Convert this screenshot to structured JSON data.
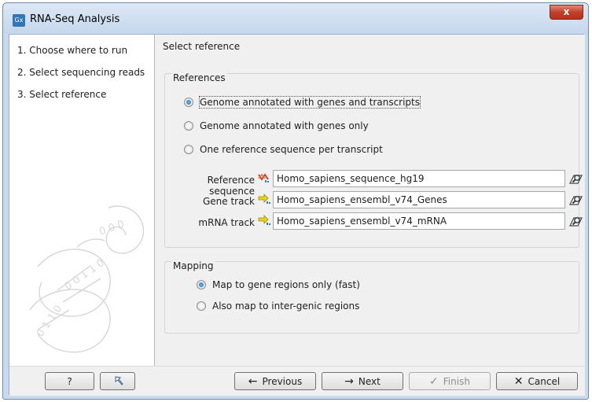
{
  "window": {
    "title": "RNA-Seq Analysis",
    "app_icon_text": "Gx",
    "close_label": "x"
  },
  "steps": [
    {
      "label": "1.  Choose where to run"
    },
    {
      "label": "2.  Select sequencing reads"
    },
    {
      "label": "3.  Select reference"
    }
  ],
  "main": {
    "section_title": "Select reference",
    "references": {
      "title": "References",
      "options": [
        {
          "label": "Genome annotated with genes and transcripts",
          "selected": true
        },
        {
          "label": "Genome annotated with genes only",
          "selected": false
        },
        {
          "label": "One reference sequence per transcript",
          "selected": false
        }
      ],
      "fields": [
        {
          "label": "Reference sequence",
          "value": "Homo_sapiens_sequence_hg19",
          "icon": "sequence-track-icon"
        },
        {
          "label": "Gene track",
          "value": "Homo_sapiens_ensembl_v74_Genes",
          "icon": "annotation-track-icon"
        },
        {
          "label": "mRNA track",
          "value": "Homo_sapiens_ensembl_v74_mRNA",
          "icon": "annotation-track-icon"
        }
      ]
    },
    "mapping": {
      "title": "Mapping",
      "options": [
        {
          "label": "Map to gene regions only (fast)",
          "selected": true
        },
        {
          "label": "Also map to inter-genic regions",
          "selected": false
        }
      ]
    }
  },
  "footer": {
    "help_label": "?",
    "previous_label": "Previous",
    "next_label": "Next",
    "finish_label": "Finish",
    "cancel_label": "Cancel"
  },
  "colors": {
    "title_bar": "#c6d7ec",
    "close_button": "#c2402a",
    "panel_bg": "#f0f0f0"
  }
}
